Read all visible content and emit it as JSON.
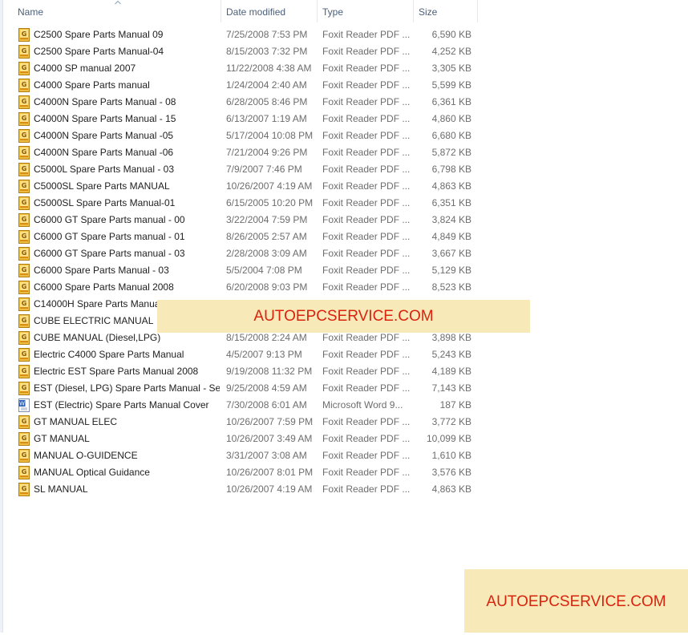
{
  "columns": {
    "name": "Name",
    "date": "Date modified",
    "type": "Type",
    "size": "Size"
  },
  "files": [
    {
      "name": "C2500 Spare Parts Manual 09",
      "date": "7/25/2008 7:53 PM",
      "type": "Foxit Reader PDF ...",
      "size": "6,590 KB",
      "icon": "pdf-icon"
    },
    {
      "name": "C2500 Spare Parts Manual-04",
      "date": "8/15/2003 7:32 PM",
      "type": "Foxit Reader PDF ...",
      "size": "4,252 KB",
      "icon": "pdf-icon"
    },
    {
      "name": "C4000 SP manual 2007",
      "date": "11/22/2008 4:38 AM",
      "type": "Foxit Reader PDF ...",
      "size": "3,305 KB",
      "icon": "pdf-icon"
    },
    {
      "name": "C4000 Spare Parts manual",
      "date": "1/24/2004 2:40 AM",
      "type": "Foxit Reader PDF ...",
      "size": "5,599 KB",
      "icon": "pdf-icon"
    },
    {
      "name": "C4000N Spare Parts Manual - 08",
      "date": "6/28/2005 8:46 PM",
      "type": "Foxit Reader PDF ...",
      "size": "6,361 KB",
      "icon": "pdf-icon"
    },
    {
      "name": "C4000N Spare Parts Manual - 15",
      "date": "6/13/2007 1:19 AM",
      "type": "Foxit Reader PDF ...",
      "size": "4,860 KB",
      "icon": "pdf-icon"
    },
    {
      "name": "C4000N Spare Parts Manual -05",
      "date": "5/17/2004 10:08 PM",
      "type": "Foxit Reader PDF ...",
      "size": "6,680 KB",
      "icon": "pdf-icon"
    },
    {
      "name": "C4000N Spare Parts Manual -06",
      "date": "7/21/2004 9:26 PM",
      "type": "Foxit Reader PDF ...",
      "size": "5,872 KB",
      "icon": "pdf-icon"
    },
    {
      "name": "C5000L Spare Parts Manual - 03",
      "date": "7/9/2007 7:46 PM",
      "type": "Foxit Reader PDF ...",
      "size": "6,798 KB",
      "icon": "pdf-icon"
    },
    {
      "name": "C5000SL Spare Parts MANUAL",
      "date": "10/26/2007 4:19 AM",
      "type": "Foxit Reader PDF ...",
      "size": "4,863 KB",
      "icon": "pdf-icon"
    },
    {
      "name": "C5000SL Spare Parts Manual-01",
      "date": "6/15/2005 10:20 PM",
      "type": "Foxit Reader PDF ...",
      "size": "6,351 KB",
      "icon": "pdf-icon"
    },
    {
      "name": "C6000 GT Spare Parts manual - 00",
      "date": "3/22/2004 7:59 PM",
      "type": "Foxit Reader PDF ...",
      "size": "3,824 KB",
      "icon": "pdf-icon"
    },
    {
      "name": "C6000 GT Spare Parts manual - 01",
      "date": "8/26/2005 2:57 AM",
      "type": "Foxit Reader PDF ...",
      "size": "4,849 KB",
      "icon": "pdf-icon"
    },
    {
      "name": "C6000 GT Spare Parts manual - 03",
      "date": "2/28/2008 3:09 AM",
      "type": "Foxit Reader PDF ...",
      "size": "3,667 KB",
      "icon": "pdf-icon"
    },
    {
      "name": "C6000 Spare Parts Manual - 03",
      "date": "5/5/2004 7:08 PM",
      "type": "Foxit Reader PDF ...",
      "size": "5,129 KB",
      "icon": "pdf-icon"
    },
    {
      "name": "C6000 Spare Parts Manual 2008",
      "date": "6/20/2008 9:03 PM",
      "type": "Foxit Reader PDF ...",
      "size": "8,523 KB",
      "icon": "pdf-icon"
    },
    {
      "name": "C14000H Spare Parts Manual",
      "date": "",
      "type": "",
      "size": "",
      "icon": "pdf-icon"
    },
    {
      "name": "CUBE ELECTRIC MANUAL",
      "date": "",
      "type": "",
      "size": "",
      "icon": "pdf-icon"
    },
    {
      "name": "CUBE MANUAL (Diesel,LPG)",
      "date": "8/15/2008 2:24 AM",
      "type": "Foxit Reader PDF ...",
      "size": "3,898 KB",
      "icon": "pdf-icon"
    },
    {
      "name": "Electric C4000 Spare Parts Manual",
      "date": "4/5/2007 9:13 PM",
      "type": "Foxit Reader PDF ...",
      "size": "5,243 KB",
      "icon": "pdf-icon"
    },
    {
      "name": "Electric EST Spare Parts Manual 2008",
      "date": "9/19/2008 11:32 PM",
      "type": "Foxit Reader PDF ...",
      "size": "4,189 KB",
      "icon": "pdf-icon"
    },
    {
      "name": "EST (Diesel, LPG) Spare Parts Manual - Se...",
      "date": "9/25/2008 4:59 AM",
      "type": "Foxit Reader PDF ...",
      "size": "7,143 KB",
      "icon": "pdf-icon"
    },
    {
      "name": "EST (Electric) Spare Parts Manual Cover",
      "date": "7/30/2008 6:01 AM",
      "type": "Microsoft Word 9...",
      "size": "187 KB",
      "icon": "word-doc-icon"
    },
    {
      "name": "GT MANUAL ELEC",
      "date": "10/26/2007 7:59 PM",
      "type": "Foxit Reader PDF ...",
      "size": "3,772 KB",
      "icon": "pdf-icon"
    },
    {
      "name": "GT MANUAL",
      "date": "10/26/2007 3:49 AM",
      "type": "Foxit Reader PDF ...",
      "size": "10,099 KB",
      "icon": "pdf-icon"
    },
    {
      "name": "MANUAL O-GUIDENCE",
      "date": "3/31/2007 3:08 AM",
      "type": "Foxit Reader PDF ...",
      "size": "1,610 KB",
      "icon": "pdf-icon"
    },
    {
      "name": "MANUAL Optical Guidance",
      "date": "10/26/2007 8:01 PM",
      "type": "Foxit Reader PDF ...",
      "size": "3,576 KB",
      "icon": "pdf-icon"
    },
    {
      "name": "SL MANUAL",
      "date": "10/26/2007 4:19 AM",
      "type": "Foxit Reader PDF ...",
      "size": "4,863 KB",
      "icon": "pdf-icon"
    }
  ],
  "watermarks": {
    "center": "AUTOEPCSERVICE.COM",
    "corner": "AUTOEPCSERVICE.COM"
  },
  "colors": {
    "header_text": "#4c607a",
    "secondary_text": "#6d6d6d",
    "watermark_bg": "#f7e9b8",
    "watermark_text": "#d9230f"
  }
}
